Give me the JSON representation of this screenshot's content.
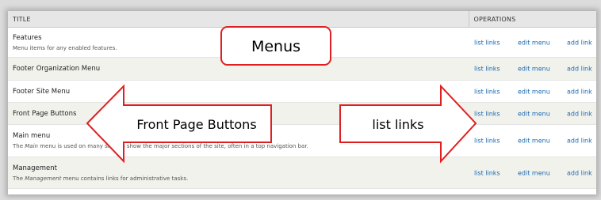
{
  "table": {
    "headers": {
      "title": "TITLE",
      "operations": "OPERATIONS"
    },
    "rows": [
      {
        "title": "Features",
        "desc_pre": "Menu items for any enabled features.",
        "desc_em": "",
        "desc_post": ""
      },
      {
        "title": "Footer Organization Menu",
        "desc_pre": "",
        "desc_em": "",
        "desc_post": ""
      },
      {
        "title": "Footer Site Menu",
        "desc_pre": "",
        "desc_em": "",
        "desc_post": ""
      },
      {
        "title": "Front Page Buttons",
        "desc_pre": "",
        "desc_em": "",
        "desc_post": ""
      },
      {
        "title": "Main menu",
        "desc_pre": "The ",
        "desc_em": "Main",
        "desc_post": " menu is used on many sites to show the major sections of the site, often in a top navigation bar."
      },
      {
        "title": "Management",
        "desc_pre": "The ",
        "desc_em": "Management",
        "desc_post": " menu contains links for administrative tasks."
      }
    ],
    "ops": {
      "list_links": "list links",
      "edit_menu": "edit menu",
      "add_link": "add link"
    }
  },
  "callouts": {
    "menus": "Menus",
    "front_page_buttons": "Front Page Buttons",
    "list_links": "list links"
  },
  "colors": {
    "link": "#1a6ab1",
    "callout_stroke": "#e02020",
    "row_alt": "#f2f2ec"
  }
}
